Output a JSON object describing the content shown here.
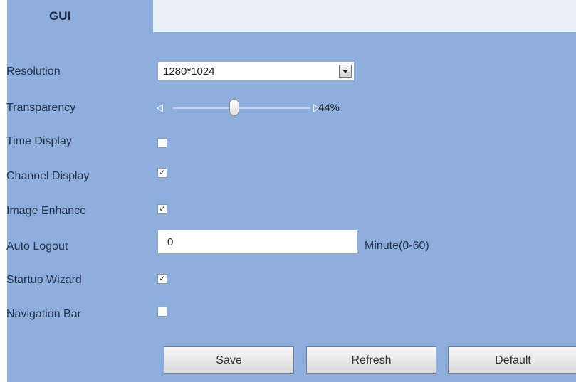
{
  "tab": {
    "label": "GUI"
  },
  "rows": {
    "resolution": {
      "label": "Resolution",
      "value": "1280*1024"
    },
    "transparency": {
      "label": "Transparency",
      "value_text": "44%",
      "value": 44
    },
    "time_display": {
      "label": "Time Display",
      "checked": false
    },
    "channel_display": {
      "label": "Channel Display",
      "checked": true
    },
    "image_enhance": {
      "label": "Image Enhance",
      "checked": true
    },
    "auto_logout": {
      "label": "Auto Logout",
      "value": "0",
      "unit": "Minute(0-60)"
    },
    "startup_wizard": {
      "label": "Startup Wizard",
      "checked": true
    },
    "navigation_bar": {
      "label": "Navigation Bar",
      "checked": false
    }
  },
  "buttons": {
    "save": "Save",
    "refresh": "Refresh",
    "default": "Default"
  },
  "colors": {
    "panel_bg": "#8eaedd",
    "tab_strip": "#eaf0f8"
  }
}
